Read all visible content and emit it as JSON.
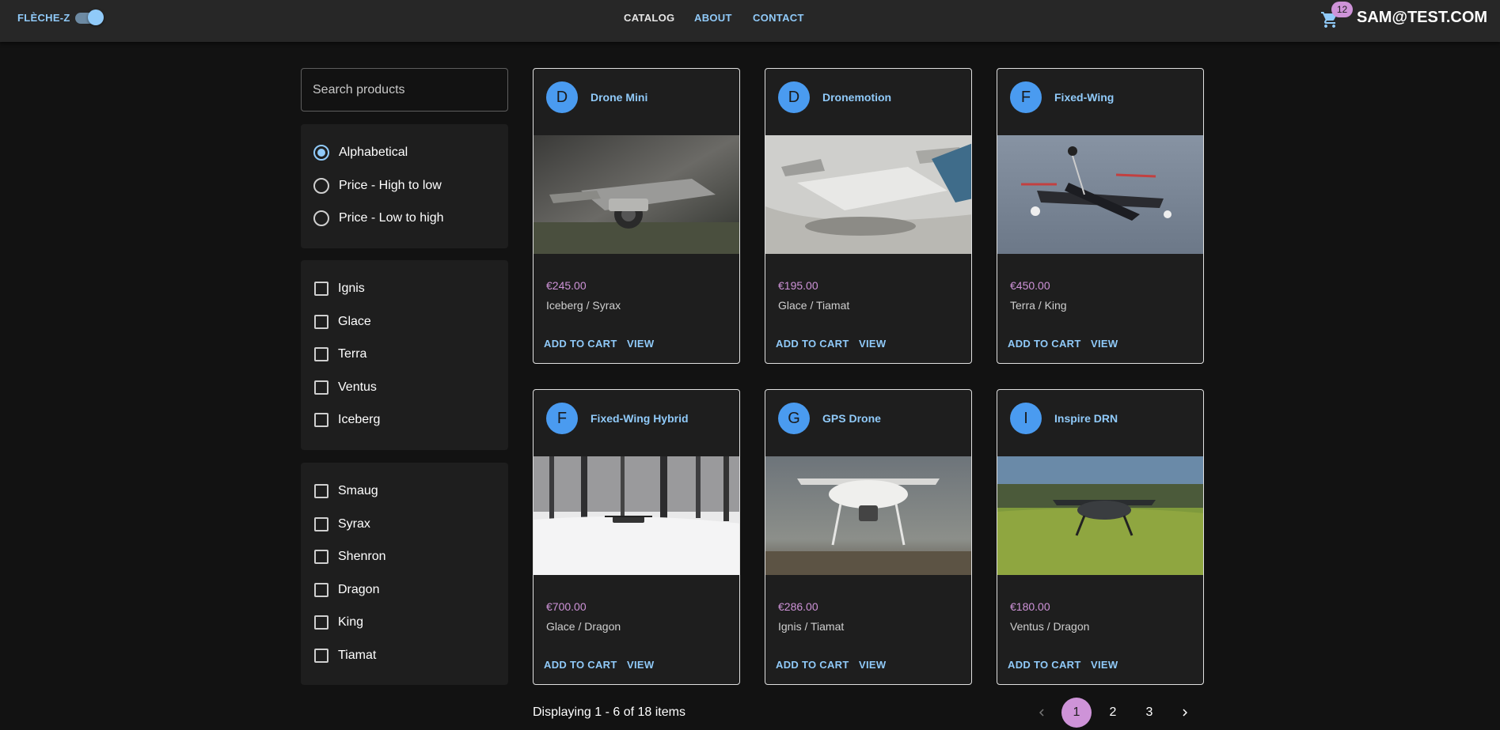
{
  "header": {
    "brand": "FLÈCHE-Z",
    "nav": {
      "catalog": "CATALOG",
      "about": "ABOUT",
      "contact": "CONTACT"
    },
    "cart_count": "12",
    "user": "SAM@TEST.COM"
  },
  "sidebar": {
    "search_placeholder": "Search products",
    "sort": [
      {
        "label": "Alphabetical",
        "selected": true
      },
      {
        "label": "Price - High to low",
        "selected": false
      },
      {
        "label": "Price - Low to high",
        "selected": false
      }
    ],
    "elements": [
      "Ignis",
      "Glace",
      "Terra",
      "Ventus",
      "Iceberg"
    ],
    "dragons": [
      "Smaug",
      "Syrax",
      "Shenron",
      "Dragon",
      "King",
      "Tiamat"
    ]
  },
  "products": [
    {
      "initial": "D",
      "name": "Drone Mini",
      "price": "€245.00",
      "tags": "Iceberg / Syrax",
      "add_label": "ADD TO CART",
      "view_label": "VIEW"
    },
    {
      "initial": "D",
      "name": "Dronemotion",
      "price": "€195.00",
      "tags": "Glace / Tiamat",
      "add_label": "ADD TO CART",
      "view_label": "VIEW"
    },
    {
      "initial": "F",
      "name": "Fixed-Wing",
      "price": "€450.00",
      "tags": "Terra / King",
      "add_label": "ADD TO CART",
      "view_label": "VIEW"
    },
    {
      "initial": "F",
      "name": "Fixed-Wing Hybrid",
      "price": "€700.00",
      "tags": "Glace / Dragon",
      "add_label": "ADD TO CART",
      "view_label": "VIEW"
    },
    {
      "initial": "G",
      "name": "GPS Drone",
      "price": "€286.00",
      "tags": "Ignis / Tiamat",
      "add_label": "ADD TO CART",
      "view_label": "VIEW"
    },
    {
      "initial": "I",
      "name": "Inspire DRN",
      "price": "€180.00",
      "tags": "Ventus / Dragon",
      "add_label": "ADD TO CART",
      "view_label": "VIEW"
    }
  ],
  "footer": {
    "display_text": "Displaying 1 - 6 of 18 items",
    "pages": [
      "1",
      "2",
      "3"
    ],
    "current_page": "1"
  },
  "colors": {
    "accent": "#90caf9",
    "secondary": "#ce93d8",
    "background": "#121212",
    "surface": "#1e1e1e"
  }
}
